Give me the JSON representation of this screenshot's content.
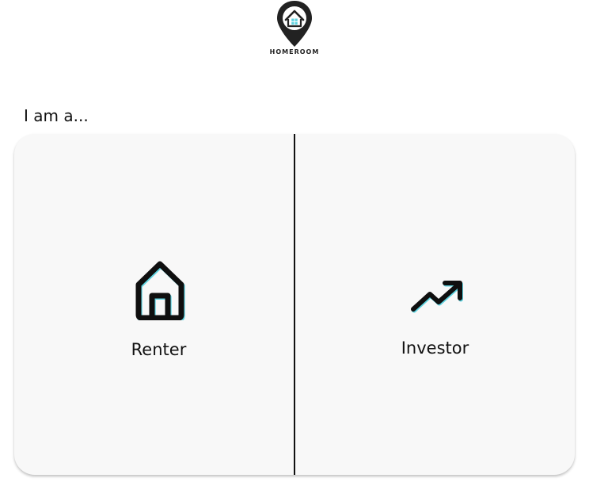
{
  "brand": {
    "name": "HOMEROOM",
    "logo_icon": "location-pin-house-icon",
    "accent_color": "#5fd3e0"
  },
  "prompt": {
    "text": "I am a..."
  },
  "options": [
    {
      "label": "Renter",
      "icon": "house-icon"
    },
    {
      "label": "Investor",
      "icon": "trending-up-icon"
    }
  ]
}
